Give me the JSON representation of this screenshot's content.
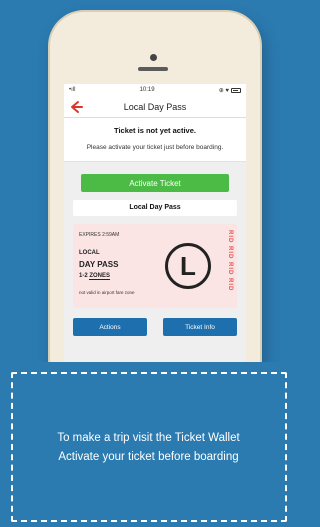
{
  "status_bar": {
    "signal": "•ıll",
    "time": "10:19",
    "icons": "⊕ ♥"
  },
  "nav": {
    "title": "Local Day Pass"
  },
  "notice": {
    "title": "Ticket is not yet active.",
    "message": "Please activate your ticket just before boarding."
  },
  "activate_button": "Activate Ticket",
  "pass_name": "Local Day Pass",
  "ticket": {
    "expires": "EXPIRES 2:59AM",
    "type_line1": "LOCAL",
    "type_line2": "DAY PASS",
    "zones_prefix": "1-2",
    "zones_word": "ZONES",
    "note": "not valid in airport fare zone",
    "badge": "L",
    "side_text": "RID RID RID RID"
  },
  "actions": {
    "actions_label": "Actions",
    "info_label": "Ticket Info"
  },
  "caption": {
    "line1": "To make a trip visit the Ticket Wallet",
    "line2": "Activate your ticket before boarding"
  },
  "colors": {
    "background": "#2b7ab0",
    "accent_red": "#d9372b",
    "activate_green": "#4cbb46",
    "action_blue": "#1d6fae",
    "ticket_pink": "#fbe5e4"
  }
}
